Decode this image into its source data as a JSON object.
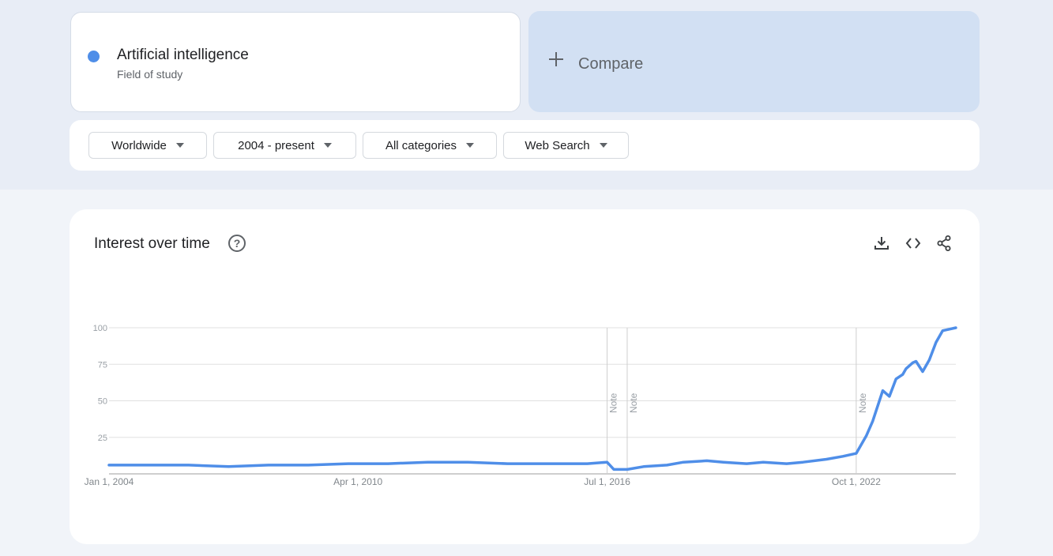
{
  "term": {
    "name": "Artificial intelligence",
    "category": "Field of study",
    "color": "#4f8ee8"
  },
  "compare": {
    "label": "Compare",
    "icon": "plus-icon"
  },
  "filters": [
    {
      "label": "Worldwide",
      "icon": "caret-down-icon"
    },
    {
      "label": "2004 - present",
      "icon": "caret-down-icon"
    },
    {
      "label": "All categories",
      "icon": "caret-down-icon"
    },
    {
      "label": "Web Search",
      "icon": "caret-down-icon"
    }
  ],
  "interest_card": {
    "title": "Interest over time",
    "help_icon": "help-icon",
    "help_glyph": "?",
    "actions": [
      "download-icon",
      "embed-code-icon",
      "share-icon"
    ]
  },
  "chart_data": {
    "type": "line",
    "series": [
      {
        "color": "#4f8ee8"
      }
    ],
    "x": [
      "2004-01",
      "2005-01",
      "2006-01",
      "2007-01",
      "2008-01",
      "2009-01",
      "2010-01",
      "2011-01",
      "2012-01",
      "2013-01",
      "2014-01",
      "2015-01",
      "2016-01",
      "2016-07",
      "2016-09",
      "2016-12",
      "2017-01",
      "2017-06",
      "2018-01",
      "2018-06",
      "2019-01",
      "2019-06",
      "2020-01",
      "2020-06",
      "2021-01",
      "2021-06",
      "2022-01",
      "2022-06",
      "2022-10",
      "2023-01",
      "2023-03",
      "2023-06",
      "2023-08",
      "2023-10",
      "2023-12",
      "2024-01",
      "2024-03",
      "2024-04",
      "2024-06",
      "2024-08",
      "2024-10",
      "2024-12",
      "2025-02",
      "2025-04"
    ],
    "y": [
      6,
      6,
      6,
      5,
      6,
      6,
      7,
      7,
      8,
      8,
      7,
      7,
      7,
      8,
      3,
      3,
      3,
      5,
      6,
      8,
      9,
      8,
      7,
      8,
      7,
      8,
      10,
      12,
      14,
      26,
      36,
      57,
      53,
      65,
      68,
      72,
      76,
      77,
      70,
      78,
      90,
      98,
      99,
      100
    ],
    "xticks": [
      "Jan 1, 2004",
      "Apr 1, 2010",
      "Jul 1, 2016",
      "Oct 1, 2022"
    ],
    "yticks": [
      "100",
      "75",
      "50",
      "25"
    ],
    "ylim": [
      0,
      100
    ],
    "notes": [
      "Note",
      "Note",
      "Note"
    ],
    "grid": true
  }
}
